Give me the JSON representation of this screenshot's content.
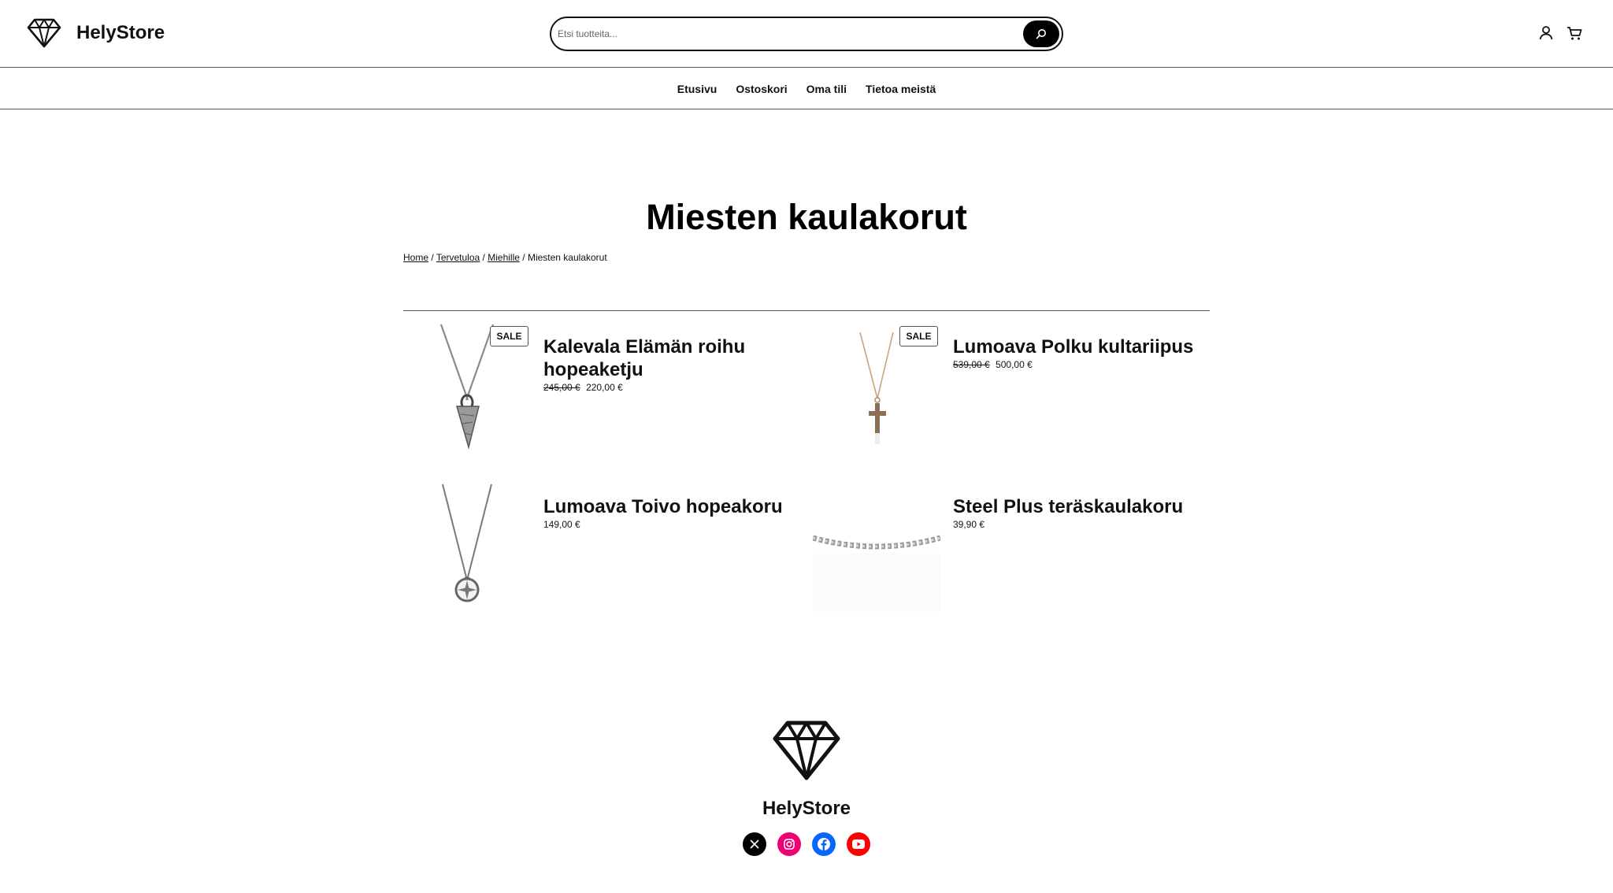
{
  "brand": {
    "name": "HelyStore"
  },
  "search": {
    "placeholder": "Etsi tuotteita..."
  },
  "header_icons": [
    "account-icon",
    "cart-icon"
  ],
  "nav": {
    "items": [
      "Etusivu",
      "Ostoskori",
      "Oma tili",
      "Tietoa meistä"
    ]
  },
  "page": {
    "title": "Miesten kaulakorut"
  },
  "breadcrumb": {
    "items": [
      "Home",
      "Tervetuloa",
      "Miehille"
    ],
    "separator": "/",
    "current": "Miesten kaulakorut"
  },
  "products": [
    {
      "name": "Kalevala Elämän roihu hopeaketju",
      "badge": "SALE",
      "old_price": "245,00 €",
      "price": "220,00 €"
    },
    {
      "name": "Lumoava Polku kultariipus",
      "badge": "SALE",
      "old_price": "539,00 €",
      "price": "500,00 €"
    },
    {
      "name": "Lumoava Toivo hopeakoru",
      "price": "149,00 €"
    },
    {
      "name": "Steel Plus teräskaulakoru",
      "price": "39,90 €"
    }
  ],
  "footer": {
    "name": "HelyStore",
    "social": [
      {
        "name": "x-icon",
        "color": "#000000"
      },
      {
        "name": "instagram-icon",
        "color": "#f00075"
      },
      {
        "name": "facebook-icon",
        "color": "#0866ff"
      },
      {
        "name": "youtube-icon",
        "color": "#ff0000"
      }
    ]
  }
}
